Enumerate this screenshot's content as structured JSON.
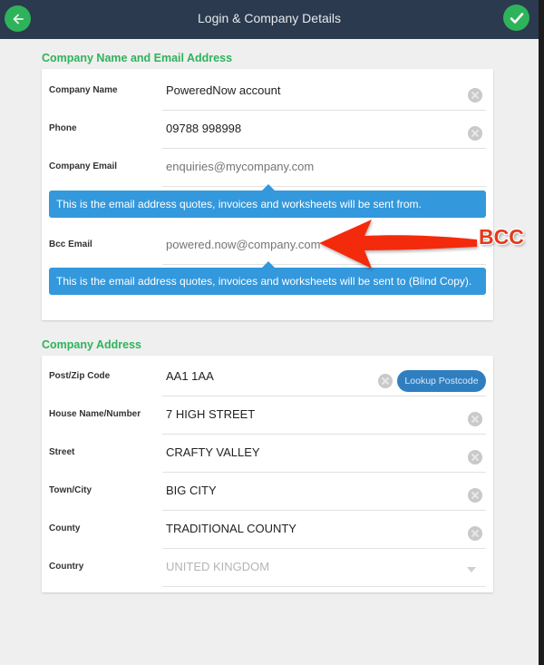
{
  "header": {
    "title": "Login & Company Details",
    "back_icon": "arrow-left-icon",
    "confirm_icon": "checkmark-icon"
  },
  "section_company": {
    "title": "Company Name and Email Address",
    "fields": {
      "company_name": {
        "label": "Company Name",
        "value": "PoweredNow account"
      },
      "phone": {
        "label": "Phone",
        "value": "09788 998998"
      },
      "company_email": {
        "label": "Company Email",
        "value": "",
        "placeholder": "enquiries@mycompany.com"
      },
      "bcc_email": {
        "label": "Bcc Email",
        "value": "",
        "placeholder": "powered.now@company.com"
      }
    },
    "email_tip": "This is the email address quotes, invoices and worksheets will be sent from.",
    "bcc_tip": "This is the email address quotes, invoices and worksheets will be sent to (Blind Copy)."
  },
  "section_address": {
    "title": "Company Address",
    "fields": {
      "postcode": {
        "label": "Post/Zip Code",
        "value": "AA1 1AA"
      },
      "house": {
        "label": "House Name/Number",
        "value": "7 HIGH STREET"
      },
      "street": {
        "label": "Street",
        "value": "CRAFTY VALLEY"
      },
      "town": {
        "label": "Town/City",
        "value": "BIG CITY"
      },
      "county": {
        "label": "County",
        "value": "TRADITIONAL COUNTY"
      },
      "country": {
        "label": "Country",
        "value": "UNITED KINGDOM"
      }
    },
    "lookup_button": "Lookup Postcode"
  },
  "annotation": {
    "label": "BCC",
    "color": "#e43a1c"
  },
  "colors": {
    "header_bg": "#2b3a4e",
    "accent_green": "#2eb35a",
    "tip_blue": "#3398dc",
    "button_blue": "#2f7fc0"
  }
}
